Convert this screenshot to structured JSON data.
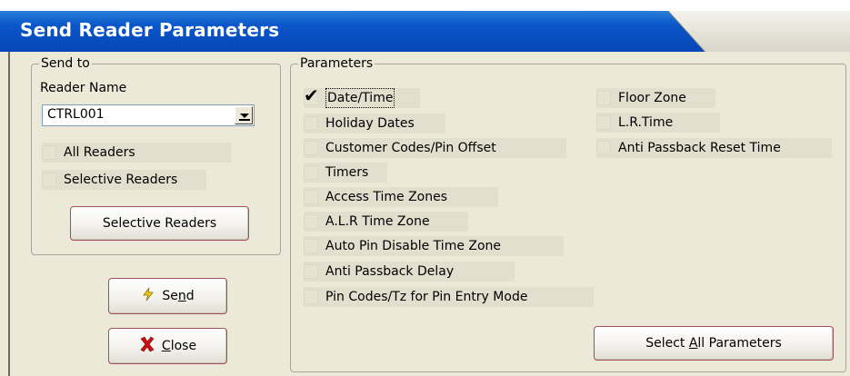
{
  "window": {
    "title": "Send Reader Parameters"
  },
  "send_to": {
    "legend": "Send to",
    "reader_name_label": "Reader Name",
    "reader_name_value": "CTRL001",
    "all_readers": {
      "label": "All Readers",
      "checked": false
    },
    "selective_readers": {
      "label": "Selective Readers",
      "checked": false
    },
    "selective_readers_button": "Selective Readers"
  },
  "buttons": {
    "send": {
      "label": "Send",
      "icon": "lightning-icon"
    },
    "close": {
      "label": "Close",
      "icon": "red-x-icon"
    },
    "select_all": "Select All Parameters"
  },
  "parameters": {
    "legend": "Parameters",
    "left": [
      {
        "label": "Date/Time",
        "checked": true
      },
      {
        "label": "Holiday Dates",
        "checked": false
      },
      {
        "label": "Customer Codes/Pin Offset",
        "checked": false
      },
      {
        "label": "Timers",
        "checked": false
      },
      {
        "label": "Access Time Zones",
        "checked": false
      },
      {
        "label": "A.L.R Time Zone",
        "checked": false
      },
      {
        "label": "Auto Pin Disable Time Zone",
        "checked": false
      },
      {
        "label": "Anti Passback Delay",
        "checked": false
      },
      {
        "label": "Pin Codes/Tz for Pin Entry Mode",
        "checked": false
      }
    ],
    "right": [
      {
        "label": "Floor Zone",
        "checked": false
      },
      {
        "label": "L.R.Time",
        "checked": false
      },
      {
        "label": "Anti Passback Reset Time",
        "checked": false
      }
    ]
  },
  "colors": {
    "titlebar": "#0646b8",
    "dialog_bg": "#ece9d8",
    "button_border": "#a0505a",
    "close_icon": "#cc1010",
    "send_icon": "#e8c000"
  }
}
